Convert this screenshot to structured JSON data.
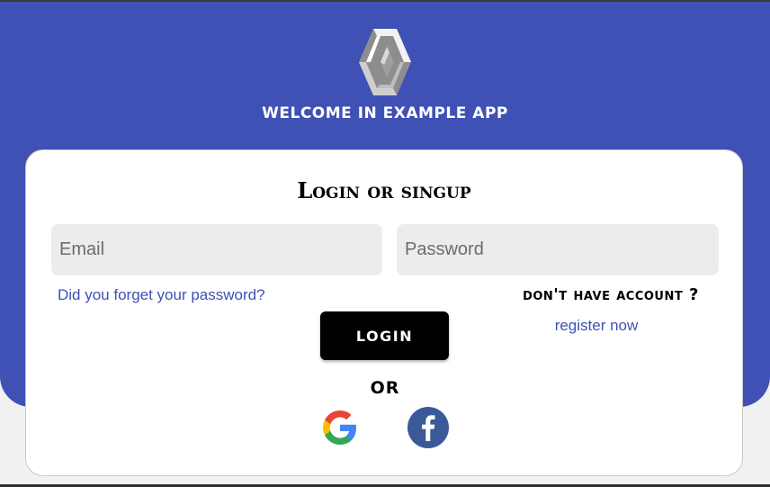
{
  "header": {
    "welcome_text": "WELCOME IN EXAMPLE APP",
    "logo_icon": "diamond-logo-icon",
    "background_color": "#3f51b5"
  },
  "card": {
    "title": "Login or singup",
    "email_placeholder": "Email",
    "email_value": "",
    "password_placeholder": "Password",
    "password_value": "",
    "forgot_password_link": "Did you forget your password?",
    "no_account_text": "don't have account ?",
    "register_link": "register now",
    "login_button": "LOGIN",
    "or_text": "OR",
    "social": {
      "google_icon": "google-icon",
      "facebook_icon": "facebook-icon"
    }
  },
  "colors": {
    "accent": "#3f51b5",
    "button": "#000000",
    "input_bg": "#ececec"
  }
}
